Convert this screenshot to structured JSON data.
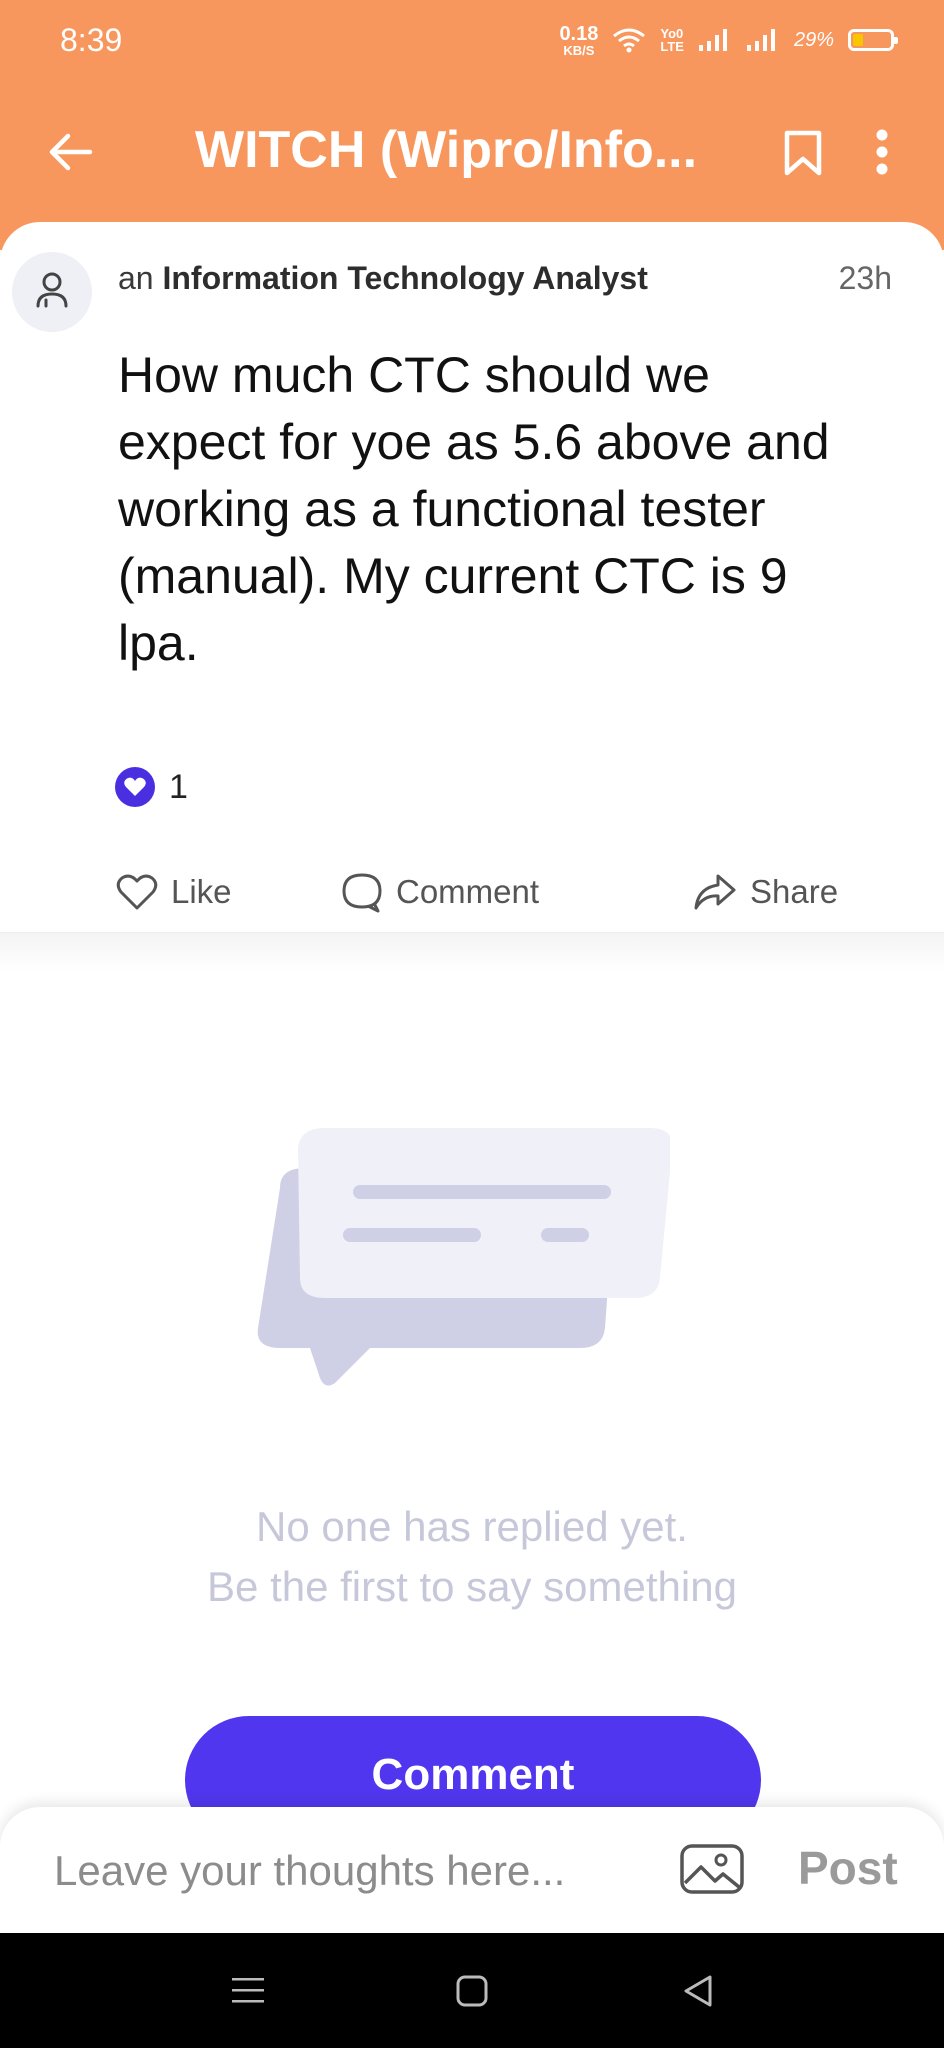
{
  "status_bar": {
    "time": "8:39",
    "net_speed_value": "0.18",
    "net_speed_unit": "KB/S",
    "volte_top": "Yo0",
    "volte_bottom": "LTE",
    "battery_percent": "29%"
  },
  "app_bar": {
    "title": "WITCH (Wipro/Info...",
    "back_icon": "arrow-left-icon",
    "bookmark_icon": "bookmark-icon",
    "more_icon": "more-vertical-icon"
  },
  "post": {
    "author_prefix": "an",
    "author_role": "Information Technology Analyst",
    "time": "23h",
    "question": "How much CTC should we expect for yoe as 5.6 above and working as a functional tester (manual). My current CTC is 9 lpa.",
    "reaction_count": "1"
  },
  "actions": {
    "like": "Like",
    "comment": "Comment",
    "share": "Share"
  },
  "empty_state": {
    "line1": "No one has replied yet.",
    "line2": "Be the first to say something"
  },
  "comment_button": "Comment",
  "composer": {
    "placeholder": "Leave your thoughts here...",
    "post_label": "Post"
  },
  "colors": {
    "header": "#f8975d",
    "accent": "#5037ef",
    "reaction": "#4a2fe0",
    "muted_text": "#c6c8da"
  }
}
